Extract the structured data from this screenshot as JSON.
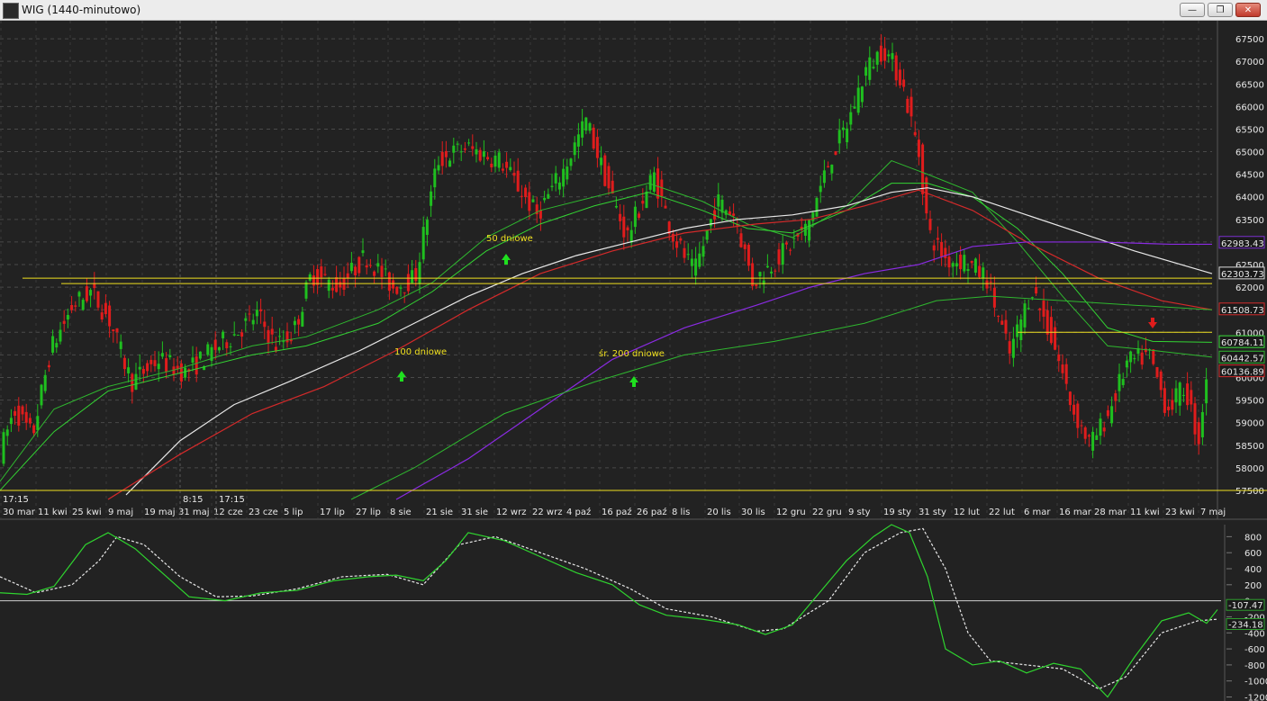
{
  "window": {
    "title": "WIG (1440-minutowo)",
    "minimize_glyph": "—",
    "restore_glyph": "❐",
    "close_glyph": "✕"
  },
  "price_axis": {
    "labels": [
      "67500",
      "67000",
      "66500",
      "66000",
      "65500",
      "65000",
      "64500",
      "64000",
      "63500",
      "63000",
      "62500",
      "62000",
      "61500",
      "61000",
      "60500",
      "60000",
      "59500",
      "59000",
      "58500",
      "58000",
      "57500"
    ],
    "min": 57300,
    "max": 67900
  },
  "date_axis": {
    "labels": [
      "30 mar",
      "11 kwi",
      "25 kwi",
      "9 maj",
      "19 maj",
      "31 maj",
      "12 cze",
      "23 cze",
      "5 lip",
      "17 lip",
      "27 lip",
      "8 sie",
      "21 sie",
      "31 sie",
      "12 wrz",
      "22 wrz",
      "4 paź",
      "16 paź",
      "26 paź",
      "8 lis",
      "20 lis",
      "30 lis",
      "12 gru",
      "22 gru",
      "9 sty",
      "19 sty",
      "31 sty",
      "12 lut",
      "22 lut",
      "6 mar",
      "16 mar",
      "28 mar",
      "11 kwi",
      "23 kwi",
      "7 maj"
    ],
    "time_labels": [
      "17:15",
      "8:15",
      "17:15"
    ]
  },
  "annotations": {
    "ma50": "50 dniowe",
    "ma100": "100 dniowe",
    "ma200": "śr. 200 dniowe"
  },
  "price_badges": [
    {
      "value": "62983.43",
      "color": "#7b2fd0"
    },
    {
      "value": "62303.73",
      "color": "#dcdcdc"
    },
    {
      "value": "61508.73",
      "color": "#d42a2a"
    },
    {
      "value": "60784.11",
      "color": "#3adf3a"
    },
    {
      "value": "60442.57",
      "color": "#2fb72f"
    },
    {
      "value": "60136.89",
      "color": "#d42a2a"
    }
  ],
  "osc_axis": {
    "labels": [
      "800",
      "600",
      "400",
      "200",
      "0",
      "-200",
      "-400",
      "-600",
      "-800",
      "-1000",
      "-1200"
    ],
    "min": -1250,
    "max": 950
  },
  "osc_badges": [
    {
      "value": "-107.47",
      "color": "#2e9e2e"
    },
    {
      "value": "-234.18",
      "color": "#2e9e2e"
    }
  ],
  "colors": {
    "background": "#222222",
    "up_candle": "#1fbf1f",
    "down_candle": "#e01c1c",
    "ma50": "#33d433",
    "ma100": "#e8e8e8",
    "ma100_red": "#d42a2a",
    "ma200": "#8a2be2",
    "support_line": "#f0e020",
    "grid": "#4a4a4a"
  }
}
